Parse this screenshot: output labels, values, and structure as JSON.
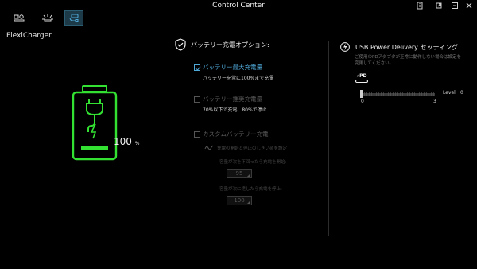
{
  "window": {
    "title": "Control Center"
  },
  "app": {
    "name": "FlexiCharger"
  },
  "battery": {
    "percent": "100",
    "percent_sign": "%",
    "accent_color": "#32e132"
  },
  "battery_options": {
    "title": "バッテリー充電オプション:",
    "max_charge": {
      "label": "バッテリー最大充電量",
      "desc": "バッテリーを常に100%まで充電",
      "checked": true
    },
    "recommended_charge": {
      "label": "バッテリー推奨充電量",
      "desc": "70%以下で充電、80%で停止",
      "checked": false
    },
    "custom_charge": {
      "label": "カスタムバッテリー充電",
      "desc": "充電の開始と停止のしきい値を設定",
      "start_label": "容量が次を下回ったら充電を開始:",
      "start_value": "95",
      "stop_label": "容量が次に達したら充電を停止:",
      "stop_value": "100",
      "checked": false
    }
  },
  "usb_pd": {
    "title": "USB Power Delivery セッティング",
    "desc_line1": "ご使用のPDアダプタが正常に動作しない場合は設定を",
    "desc_line2": "変更してください。",
    "badge": "PD",
    "level_label": "Level",
    "level_value": "0",
    "min_label": "0",
    "max_label": "3",
    "min": 0,
    "max": 3,
    "value": 0
  },
  "colors": {
    "accent_blue": "#4ea9d8",
    "battery_green": "#32e132"
  }
}
